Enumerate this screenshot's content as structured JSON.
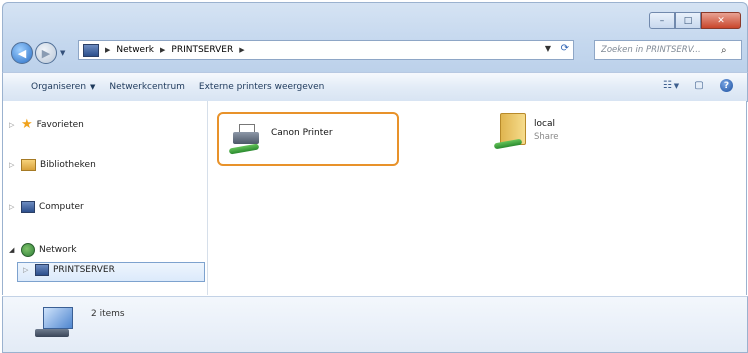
{
  "window": {
    "min_label": "–",
    "max_label": "□",
    "close_label": "✕"
  },
  "address": {
    "crumbs": [
      "Netwerk",
      "PRINTSERVER"
    ],
    "search_placeholder": "Zoeken in PRINTSERV..."
  },
  "toolbar": {
    "organize": "Organiseren",
    "network_center": "Netwerkcentrum",
    "external_printers": "Externe printers weergeven"
  },
  "nav": {
    "favorites": "Favorieten",
    "libraries": "Bibliotheken",
    "computer": "Computer",
    "network": "Network",
    "printserver": "PRINTSERVER"
  },
  "content": {
    "items": [
      {
        "name": "Canon Printer",
        "icon": "printer-icon"
      },
      {
        "name": "local",
        "subtitle": "Share",
        "icon": "shared-folder-icon"
      }
    ]
  },
  "details": {
    "count": "2 items"
  },
  "colors": {
    "highlight_border": "#e8922a",
    "chrome": "#c4d7ee"
  }
}
